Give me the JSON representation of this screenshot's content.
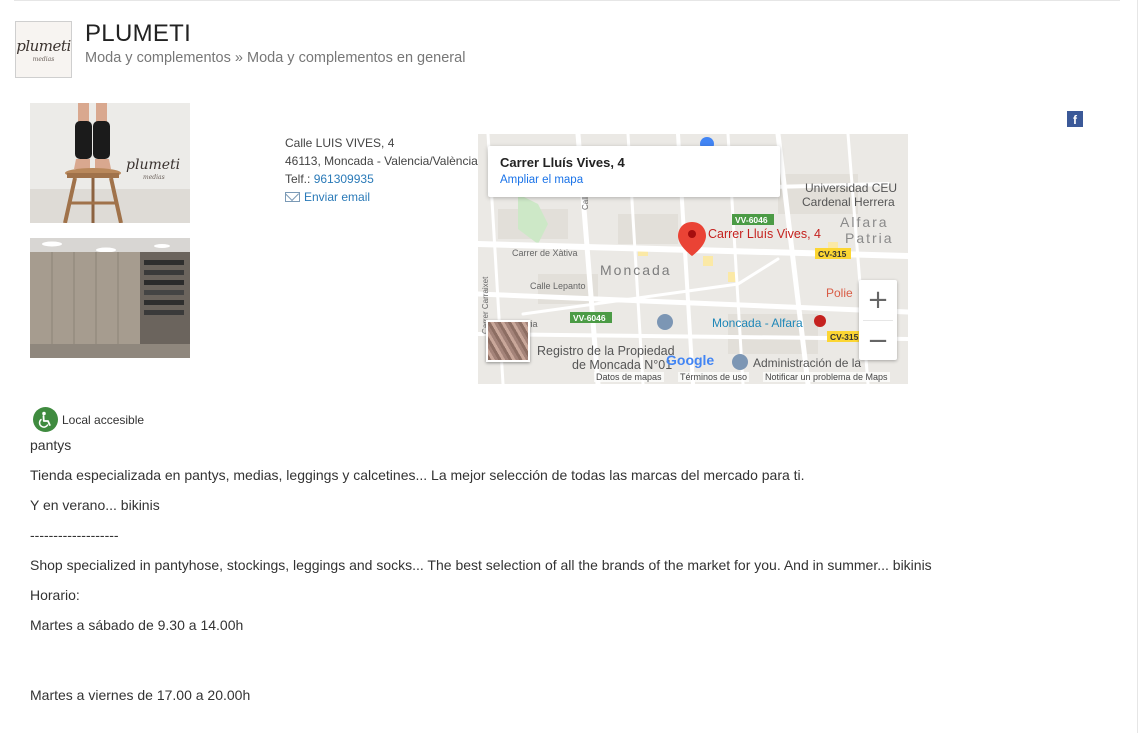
{
  "header": {
    "logo_text": "plumeti",
    "logo_subtext": "medias",
    "title": "PLUMETI",
    "breadcrumb": "Moda y complementos » Moda y complementos en general"
  },
  "photos": [
    {
      "name": "storefront-legs-photo",
      "logo_text": "plumeti",
      "logo_subtext": "medias"
    },
    {
      "name": "store-interior-photo"
    }
  ],
  "contact": {
    "street": "Calle LUIS VIVES, 4",
    "city": "46113, Moncada - Valencia/València",
    "phone_label": "Telf.: ",
    "phone": "961309935",
    "email_label": "Enviar email"
  },
  "map": {
    "card_title": "Carrer Lluís Vives, 4",
    "card_link": "Ampliar el mapa",
    "marker_label": "Carrer Lluís Vives, 4",
    "labels": {
      "university": "Universidad CEU",
      "university2": "Cardenal Herrera",
      "alfara": "Alfara",
      "patria": "Patria",
      "moncada": "Moncada",
      "xativa": "Carrer de Xàtiva",
      "lepanto": "Calle Lepanto",
      "carraixet": "Carrer Carraixet",
      "liria": "Llíria",
      "registro1": "Registro de la Propiedad",
      "registro2": "de Moncada N°01",
      "station": "Moncada - Alfara",
      "admin": "Administración de la",
      "polie": "Polie",
      "calle": "Calle",
      "road_vv6046_a": "VV-6046",
      "road_vv6046_b": "VV-6046",
      "road_cv315_a": "CV-315",
      "road_cv315_b": "CV-315",
      "google": "Google"
    },
    "footer": {
      "data": "Datos de mapas",
      "terms": "Términos de uso",
      "report": "Notificar un problema de Maps"
    },
    "zoom_in": "+",
    "zoom_out": "−"
  },
  "social": {
    "facebook_label": "f"
  },
  "accessibility": {
    "label": "Local accesible"
  },
  "description": {
    "tag": "pantys",
    "lines": [
      "Tienda especializada en pantys, medias, leggings y calcetines... La mejor selección de todas las marcas del mercado para ti.",
      "Y en verano... bikinis",
      "-------------------",
      "Shop specialized in pantyhose, stockings, leggings and socks... The best selection of all the brands of the market for you. And in summer... bikinis",
      "Horario:",
      "Martes a sábado de 9.30 a 14.00h",
      "Martes a viernes de 17.00 a 20.00h"
    ]
  },
  "colors": {
    "link": "#2a7ab8",
    "map_link": "#1a73e8",
    "marker": "#ea4335",
    "facebook": "#3b5998",
    "accessible": "#3f8b3f"
  }
}
